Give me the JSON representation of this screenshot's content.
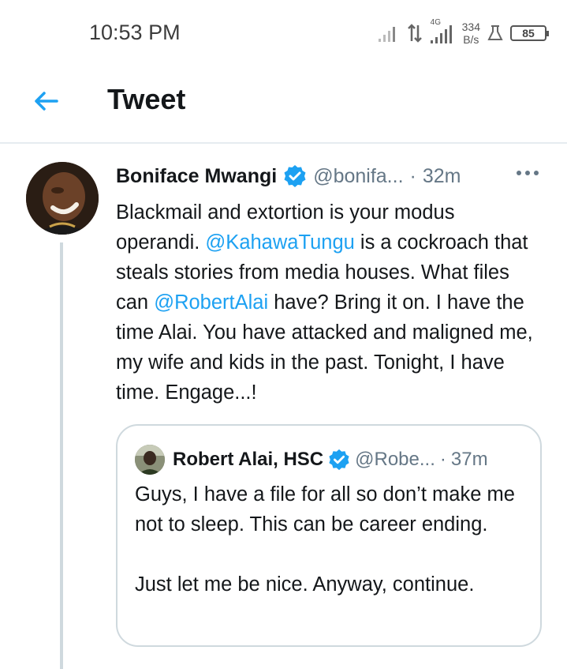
{
  "status_bar": {
    "time": "10:53 PM",
    "network_type": "4G",
    "net_speed_value": "334",
    "net_speed_unit": "B/s",
    "battery_level": "85"
  },
  "header": {
    "title": "Tweet"
  },
  "tweet": {
    "author_name": "Boniface Mwangi",
    "handle": "@bonifa...",
    "time_sep": "·",
    "time": "32m",
    "text_parts": [
      "Blackmail and extortion is your modus operandi. ",
      "@KahawaTungu",
      " is a cockroach that steals stories from media houses. What files can ",
      "@RobertAlai",
      " have? Bring it on. I have the time Alai. You have attacked and maligned me, my wife and kids in the past. Tonight, I have time. Engage...!"
    ]
  },
  "quoted_tweet": {
    "author_name": "Robert Alai, HSC",
    "handle": "@Robe...",
    "time_sep": "·",
    "time": "37m",
    "paragraph_1": "Guys, I have a file for all so don’t make me not to sleep. This can be career ending.",
    "paragraph_2": "Just let me be nice. Anyway, continue."
  },
  "colors": {
    "accent": "#1da1f2",
    "secondary_text": "#657786",
    "divider": "#cfd9de"
  }
}
